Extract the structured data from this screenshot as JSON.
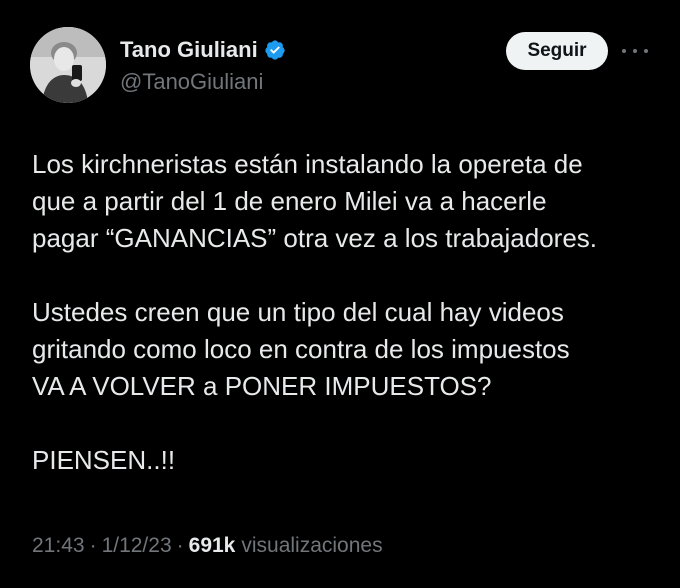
{
  "author": {
    "display_name": "Tano Giuliani",
    "handle": "@TanoGiuliani",
    "verified_icon": "verified-badge-icon",
    "verified_color": "#1d9bf0"
  },
  "actions": {
    "follow_label": "Seguir",
    "more_icon": "more-options-icon"
  },
  "tweet": {
    "paragraphs": [
      "Los kirchneristas están instalando la opereta de\nque a partir del 1 de enero Milei va a hacerle\npagar “GANANCIAS” otra vez a los trabajadores.",
      "Ustedes creen que un tipo del cual hay videos\ngritando como loco en contra de los impuestos\nVA A VOLVER a PONER IMPUESTOS?",
      "PIENSEN..!!"
    ]
  },
  "meta": {
    "time": "21:43",
    "date": "1/12/23",
    "separator": "·",
    "views_count": "691k",
    "views_label": "visualizaciones"
  },
  "colors": {
    "background": "#000000",
    "text": "#e7e9ea",
    "secondary": "#71767b",
    "button_bg": "#eff3f4"
  }
}
